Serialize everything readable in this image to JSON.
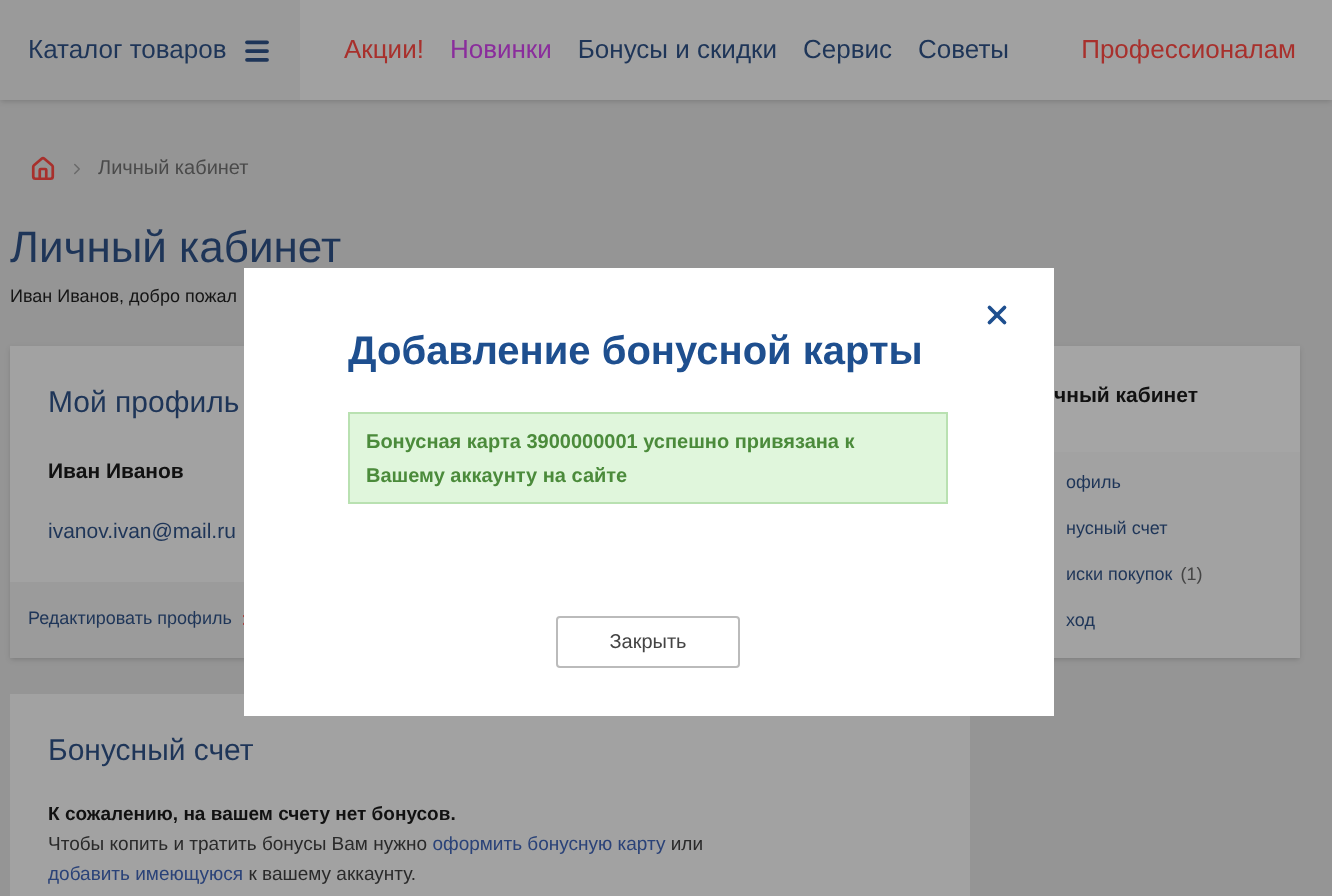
{
  "header": {
    "catalog": "Каталог товаров",
    "nav": [
      {
        "label": "Акции!",
        "color": "#a8302c"
      },
      {
        "label": "Новинки",
        "color": "#8a2d9c"
      },
      {
        "label": "Бонусы и скидки",
        "color": "#1e3558"
      },
      {
        "label": "Сервис",
        "color": "#1e3558"
      },
      {
        "label": "Советы",
        "color": "#1e3558"
      }
    ],
    "pro_link": "Профессионалам"
  },
  "breadcrumb": [
    "Личный кабинет"
  ],
  "page_title": "Личный кабинет",
  "greeting": "Иван Иванов, добро пожал",
  "profile": {
    "title": "Мой профиль",
    "name": "Иван Иванов",
    "email": "ivanov.ivan@mail.ru",
    "edit_link": "Редактировать профиль"
  },
  "bonus": {
    "title": "Бонусный счет",
    "notice": "К сожалению, на вашем счету нет бонусов.",
    "text_1": "Чтобы копить и тратить бонусы Вам нужно",
    "link_1": "оформить бонусную карту",
    "text_2": "или",
    "link_2": "добавить имеющуюся",
    "text_3": "к вашему аккаунту."
  },
  "sidebar": {
    "title": "чный кабинет",
    "items": [
      {
        "label": "офиль"
      },
      {
        "label": "нусный счет"
      },
      {
        "label": "иски покупок",
        "count": "(1)"
      },
      {
        "label": "ход"
      }
    ]
  },
  "modal": {
    "title": "Добавление бонусной карты",
    "message": "Бонусная карта 3900000001 успешно привязана к Вашему аккаунту на сайте",
    "close_button": "Закрыть"
  }
}
